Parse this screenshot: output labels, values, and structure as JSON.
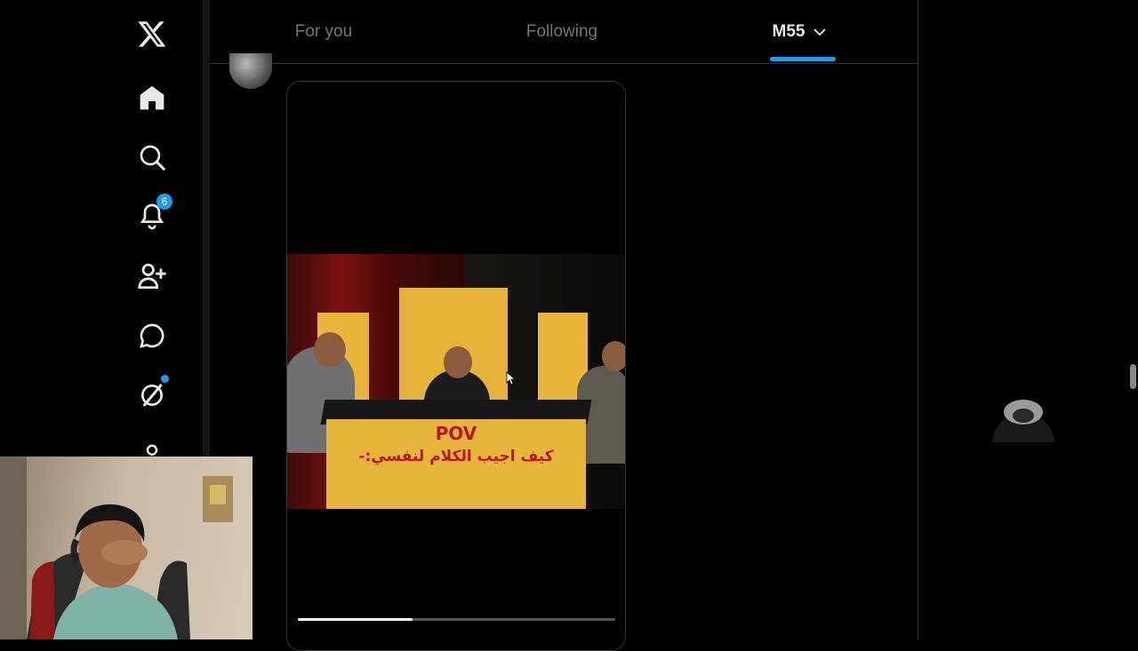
{
  "nav": {
    "items": [
      {
        "icon": "x-logo-icon"
      },
      {
        "icon": "home-icon"
      },
      {
        "icon": "search-icon"
      },
      {
        "icon": "notifications-icon",
        "badge": "6"
      },
      {
        "icon": "follow-icon"
      },
      {
        "icon": "messages-icon"
      },
      {
        "icon": "grok-icon",
        "dot": true
      },
      {
        "icon": "profile-icon"
      }
    ]
  },
  "tabs": [
    {
      "label": "For you"
    },
    {
      "label": "Following"
    },
    {
      "label": "M55",
      "active": true
    }
  ],
  "video": {
    "caption_line1": "POV",
    "caption_line2": "كيف اجيب الكلام لنفسي:-",
    "progress": 0.36
  },
  "colors": {
    "accent": "#1d9bf0",
    "background": "#000000",
    "border": "#2f3336",
    "text_primary": "#e7e9ea",
    "text_secondary": "#71767b"
  }
}
